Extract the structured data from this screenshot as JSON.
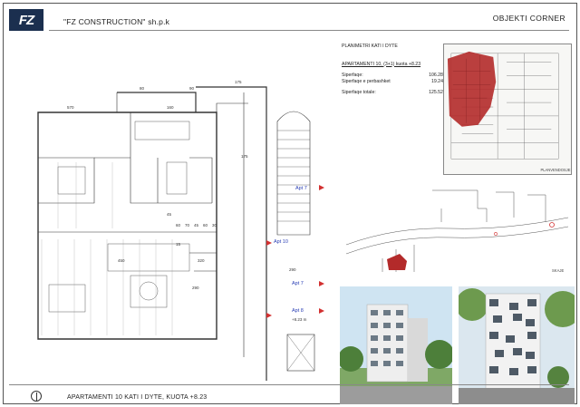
{
  "header": {
    "logo_text": "FZ",
    "company": "\"FZ CONSTRUCTION\" sh.p.k",
    "project": "OBJEKTI CORNER"
  },
  "info": {
    "title": "PLANIMETRI KATI I DYTE",
    "apartment": "APARTAMENTI 10, (3+1) kuota +8.23",
    "rows": [
      {
        "label": "Siperfaqe:",
        "value": "106.28m²"
      },
      {
        "label": "Siperfaqe e perbashket",
        "value": "19.24m²"
      },
      {
        "label": "Siperfaqe totale:",
        "value": "125.52m²"
      }
    ]
  },
  "keyplan_label": "PLANVENDOSJE",
  "siteplan_label": "SKAJE",
  "plan": {
    "apt_labels": [
      "Apt 7",
      "Apt 10",
      "Apt 7",
      "Apt 8"
    ],
    "elevation": "+8.23 m",
    "dims_top": [
      "80",
      "90",
      "175"
    ],
    "dims_mid": [
      "570",
      "160",
      "175"
    ],
    "dims_row": [
      "45",
      "60",
      "70",
      "45",
      "60",
      "30"
    ],
    "room_area": "15",
    "other_dims": [
      "450",
      "290",
      "320",
      "290"
    ]
  },
  "footer": "APARTAMENTI 10 KATI I DYTE, KUOTA +8.23",
  "colors": {
    "highlight": "#b32a2a",
    "logo_bg": "#1b2f4f",
    "apt_label": "#2a3fb5",
    "marker": "#d23030"
  }
}
